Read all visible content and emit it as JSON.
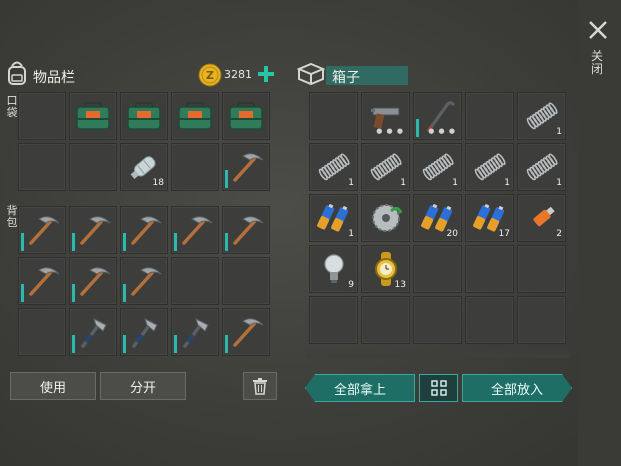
{
  "left_panel": {
    "title": "物品栏",
    "coin_count": "3281",
    "pocket_label": "口袋",
    "backpack_label": "背包",
    "use_button": "使用",
    "split_button": "分开"
  },
  "right_panel": {
    "title": "箱子",
    "take_all": "全部拿上",
    "put_all": "全部放入"
  },
  "close_label": "关闭",
  "pocket_slots": [
    {
      "item": "",
      "count": ""
    },
    {
      "item": "green-toolbox",
      "count": ""
    },
    {
      "item": "green-toolbox",
      "count": ""
    },
    {
      "item": "green-toolbox",
      "count": ""
    },
    {
      "item": "green-toolbox",
      "count": ""
    },
    {
      "item": "",
      "count": ""
    },
    {
      "item": "",
      "count": ""
    },
    {
      "item": "plastic-bottle",
      "count": "18"
    },
    {
      "item": "",
      "count": ""
    },
    {
      "item": "pickaxe",
      "count": ""
    }
  ],
  "backpack_slots": [
    {
      "item": "pickaxe",
      "count": ""
    },
    {
      "item": "pickaxe",
      "count": ""
    },
    {
      "item": "pickaxe",
      "count": ""
    },
    {
      "item": "pickaxe",
      "count": ""
    },
    {
      "item": "pickaxe",
      "count": ""
    },
    {
      "item": "pickaxe",
      "count": ""
    },
    {
      "item": "pickaxe",
      "count": ""
    },
    {
      "item": "pickaxe",
      "count": ""
    },
    {
      "item": "",
      "count": ""
    },
    {
      "item": "",
      "count": ""
    },
    {
      "item": "",
      "count": ""
    },
    {
      "item": "hatchet",
      "count": ""
    },
    {
      "item": "hatchet",
      "count": ""
    },
    {
      "item": "hatchet",
      "count": ""
    },
    {
      "item": "pickaxe",
      "count": ""
    }
  ],
  "box_slots": [
    {
      "item": "",
      "count": ""
    },
    {
      "item": "pistol",
      "count": ""
    },
    {
      "item": "crowbar",
      "count": ""
    },
    {
      "item": "",
      "count": ""
    },
    {
      "item": "spring",
      "count": "1"
    },
    {
      "item": "spring",
      "count": "1"
    },
    {
      "item": "spring",
      "count": "1"
    },
    {
      "item": "spring",
      "count": "1"
    },
    {
      "item": "spring",
      "count": "1"
    },
    {
      "item": "spring",
      "count": "1"
    },
    {
      "item": "batteries",
      "count": "1"
    },
    {
      "item": "saw-blade",
      "count": ""
    },
    {
      "item": "batteries",
      "count": "20"
    },
    {
      "item": "batteries",
      "count": "17"
    },
    {
      "item": "usb-stick",
      "count": "2"
    },
    {
      "item": "light-bulb",
      "count": "9"
    },
    {
      "item": "gold-watch",
      "count": "13"
    },
    {
      "item": "",
      "count": ""
    },
    {
      "item": "",
      "count": ""
    },
    {
      "item": "",
      "count": ""
    },
    {
      "item": "",
      "count": ""
    },
    {
      "item": "",
      "count": ""
    },
    {
      "item": "",
      "count": ""
    },
    {
      "item": "",
      "count": ""
    },
    {
      "item": "",
      "count": ""
    }
  ],
  "colors": {
    "accent_teal": "#1f6e66",
    "coin_gold": "#e8b322",
    "plus_green": "#25c6a6"
  }
}
